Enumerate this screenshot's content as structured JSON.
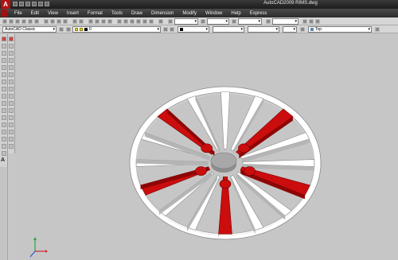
{
  "window": {
    "title": "AutoCAD2009 RIMS.dwg",
    "logo_letter": "A"
  },
  "menu": [
    "File",
    "Edit",
    "View",
    "Insert",
    "Format",
    "Tools",
    "Draw",
    "Dimension",
    "Modify",
    "Window",
    "Help",
    "Express"
  ],
  "toolbar2": {
    "workspace": "AutoCAD Classic",
    "layer_value": "0",
    "view_value": "Top"
  },
  "left_panel": {
    "text_icon_label": "A"
  },
  "colors": {
    "spoke_red": "#cc0d0d",
    "rim_white": "#ffffff",
    "background": "#c6c6c6",
    "hub_gray": "#9f9f9f"
  },
  "ucs_icon": "ucs-axis-icon"
}
